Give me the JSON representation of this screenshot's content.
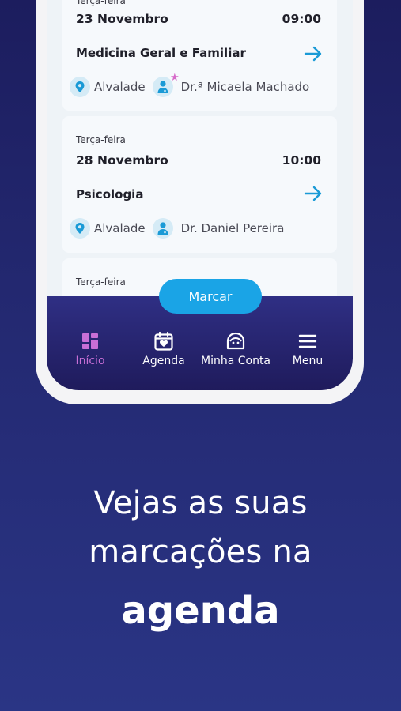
{
  "appointments": [
    {
      "weekday": "Terça-feira",
      "date": "23 Novembro",
      "time": "09:00",
      "specialty": "Medicina Geral e Familiar",
      "location": "Alvalade",
      "doctor": "Dr.ª Micaela Machado",
      "doctor_featured": true
    },
    {
      "weekday": "Terça-feira",
      "date": "28 Novembro",
      "time": "10:00",
      "specialty": "Psicologia",
      "location": "Alvalade",
      "doctor": "Dr. Daniel Pereira",
      "doctor_featured": false
    },
    {
      "weekday": "Terça-feira"
    }
  ],
  "action_button": {
    "label": "Marcar"
  },
  "tabs": [
    {
      "label": "Início",
      "icon": "dashboard-icon",
      "active": true
    },
    {
      "label": "Agenda",
      "icon": "calendar-heart-icon",
      "active": false
    },
    {
      "label": "Minha Conta",
      "icon": "face-icon",
      "active": false
    },
    {
      "label": "Menu",
      "icon": "hamburger-icon",
      "active": false
    }
  ],
  "headline": {
    "line1": "Vejas as suas",
    "line2": "marcações na",
    "line3": "agenda"
  },
  "colors": {
    "accent": "#1aa4e6",
    "active_tab": "#c86fd6",
    "background": "#232870"
  }
}
